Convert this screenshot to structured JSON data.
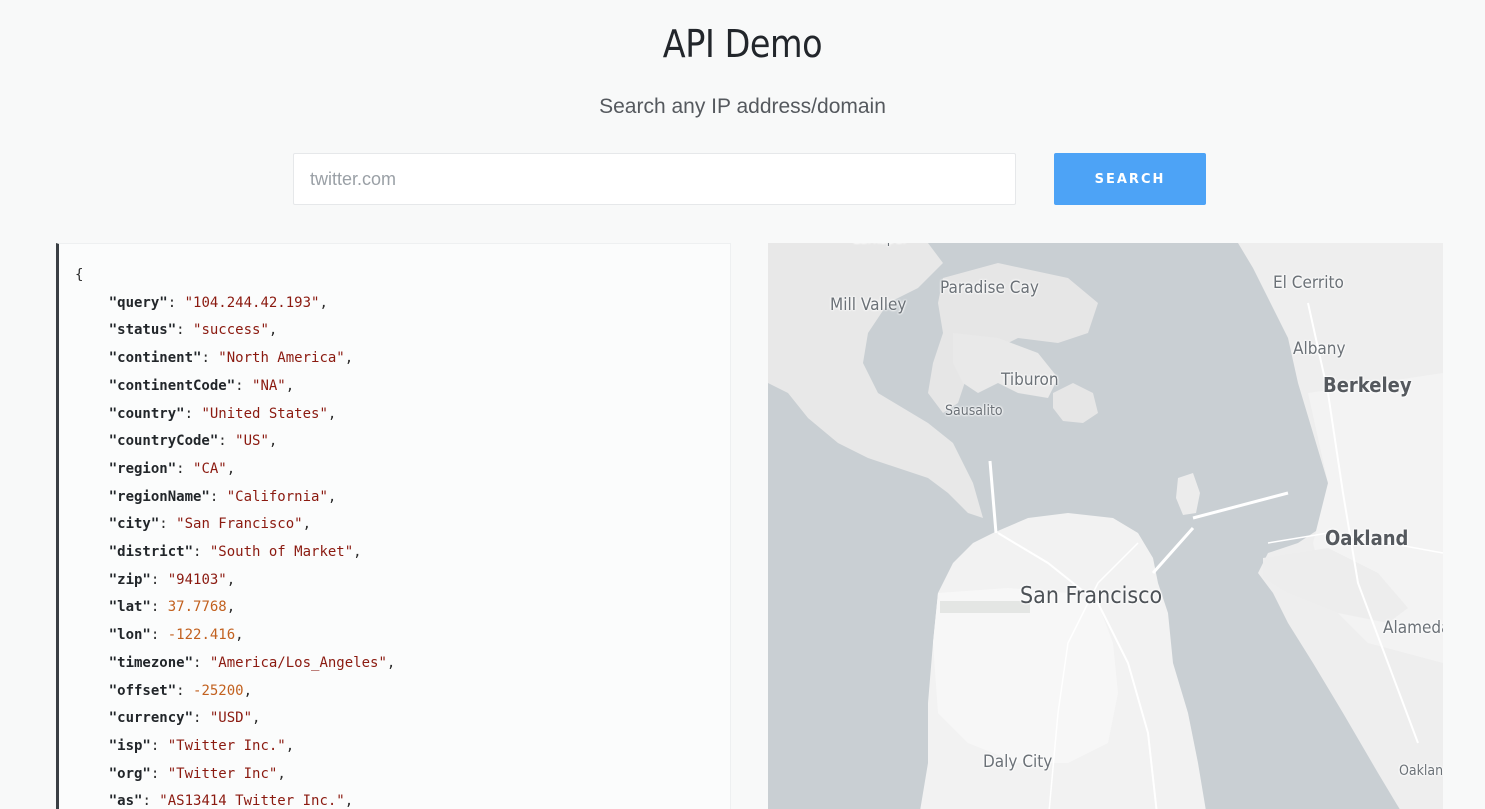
{
  "header": {
    "title": "API Demo",
    "subtitle": "Search any IP address/domain"
  },
  "search": {
    "placeholder": "twitter.com",
    "button_label": "SEARCH"
  },
  "result": {
    "open_brace": "{",
    "fields": [
      {
        "key": "query",
        "value": "104.244.42.193",
        "type": "string"
      },
      {
        "key": "status",
        "value": "success",
        "type": "string"
      },
      {
        "key": "continent",
        "value": "North America",
        "type": "string"
      },
      {
        "key": "continentCode",
        "value": "NA",
        "type": "string"
      },
      {
        "key": "country",
        "value": "United States",
        "type": "string"
      },
      {
        "key": "countryCode",
        "value": "US",
        "type": "string"
      },
      {
        "key": "region",
        "value": "CA",
        "type": "string"
      },
      {
        "key": "regionName",
        "value": "California",
        "type": "string"
      },
      {
        "key": "city",
        "value": "San Francisco",
        "type": "string"
      },
      {
        "key": "district",
        "value": "South of Market",
        "type": "string"
      },
      {
        "key": "zip",
        "value": "94103",
        "type": "string"
      },
      {
        "key": "lat",
        "value": "37.7768",
        "type": "number"
      },
      {
        "key": "lon",
        "value": "-122.416",
        "type": "number"
      },
      {
        "key": "timezone",
        "value": "America/Los_Angeles",
        "type": "string"
      },
      {
        "key": "offset",
        "value": "-25200",
        "type": "number"
      },
      {
        "key": "currency",
        "value": "USD",
        "type": "string"
      },
      {
        "key": "isp",
        "value": "Twitter Inc.",
        "type": "string"
      },
      {
        "key": "org",
        "value": "Twitter Inc",
        "type": "string"
      },
      {
        "key": "as",
        "value": "AS13414 Twitter Inc.",
        "type": "string"
      }
    ]
  },
  "map": {
    "labels": [
      {
        "name": "larkspur",
        "text": "Larkspur",
        "size": "small"
      },
      {
        "name": "mill-valley",
        "text": "Mill Valley",
        "size": "medium"
      },
      {
        "name": "paradise-cay",
        "text": "Paradise Cay",
        "size": "medium"
      },
      {
        "name": "el-cerrito",
        "text": "El Cerrito",
        "size": "medium"
      },
      {
        "name": "albany",
        "text": "Albany",
        "size": "medium"
      },
      {
        "name": "tiburon",
        "text": "Tiburon",
        "size": "medium"
      },
      {
        "name": "berkeley",
        "text": "Berkeley",
        "size": "large"
      },
      {
        "name": "sausalito",
        "text": "Sausalito",
        "size": "small"
      },
      {
        "name": "oakland",
        "text": "Oakland",
        "size": "large"
      },
      {
        "name": "san-francisco",
        "text": "San Francisco",
        "size": "xlarge"
      },
      {
        "name": "alameda",
        "text": "Alameda",
        "size": "medium"
      },
      {
        "name": "daly-city",
        "text": "Daly City",
        "size": "medium"
      },
      {
        "name": "oakland-small",
        "text": "Oakland",
        "size": "small"
      }
    ],
    "colors": {
      "water": "#c9cfd3",
      "land": "#ededed",
      "urban": "#f6f6f6"
    }
  }
}
